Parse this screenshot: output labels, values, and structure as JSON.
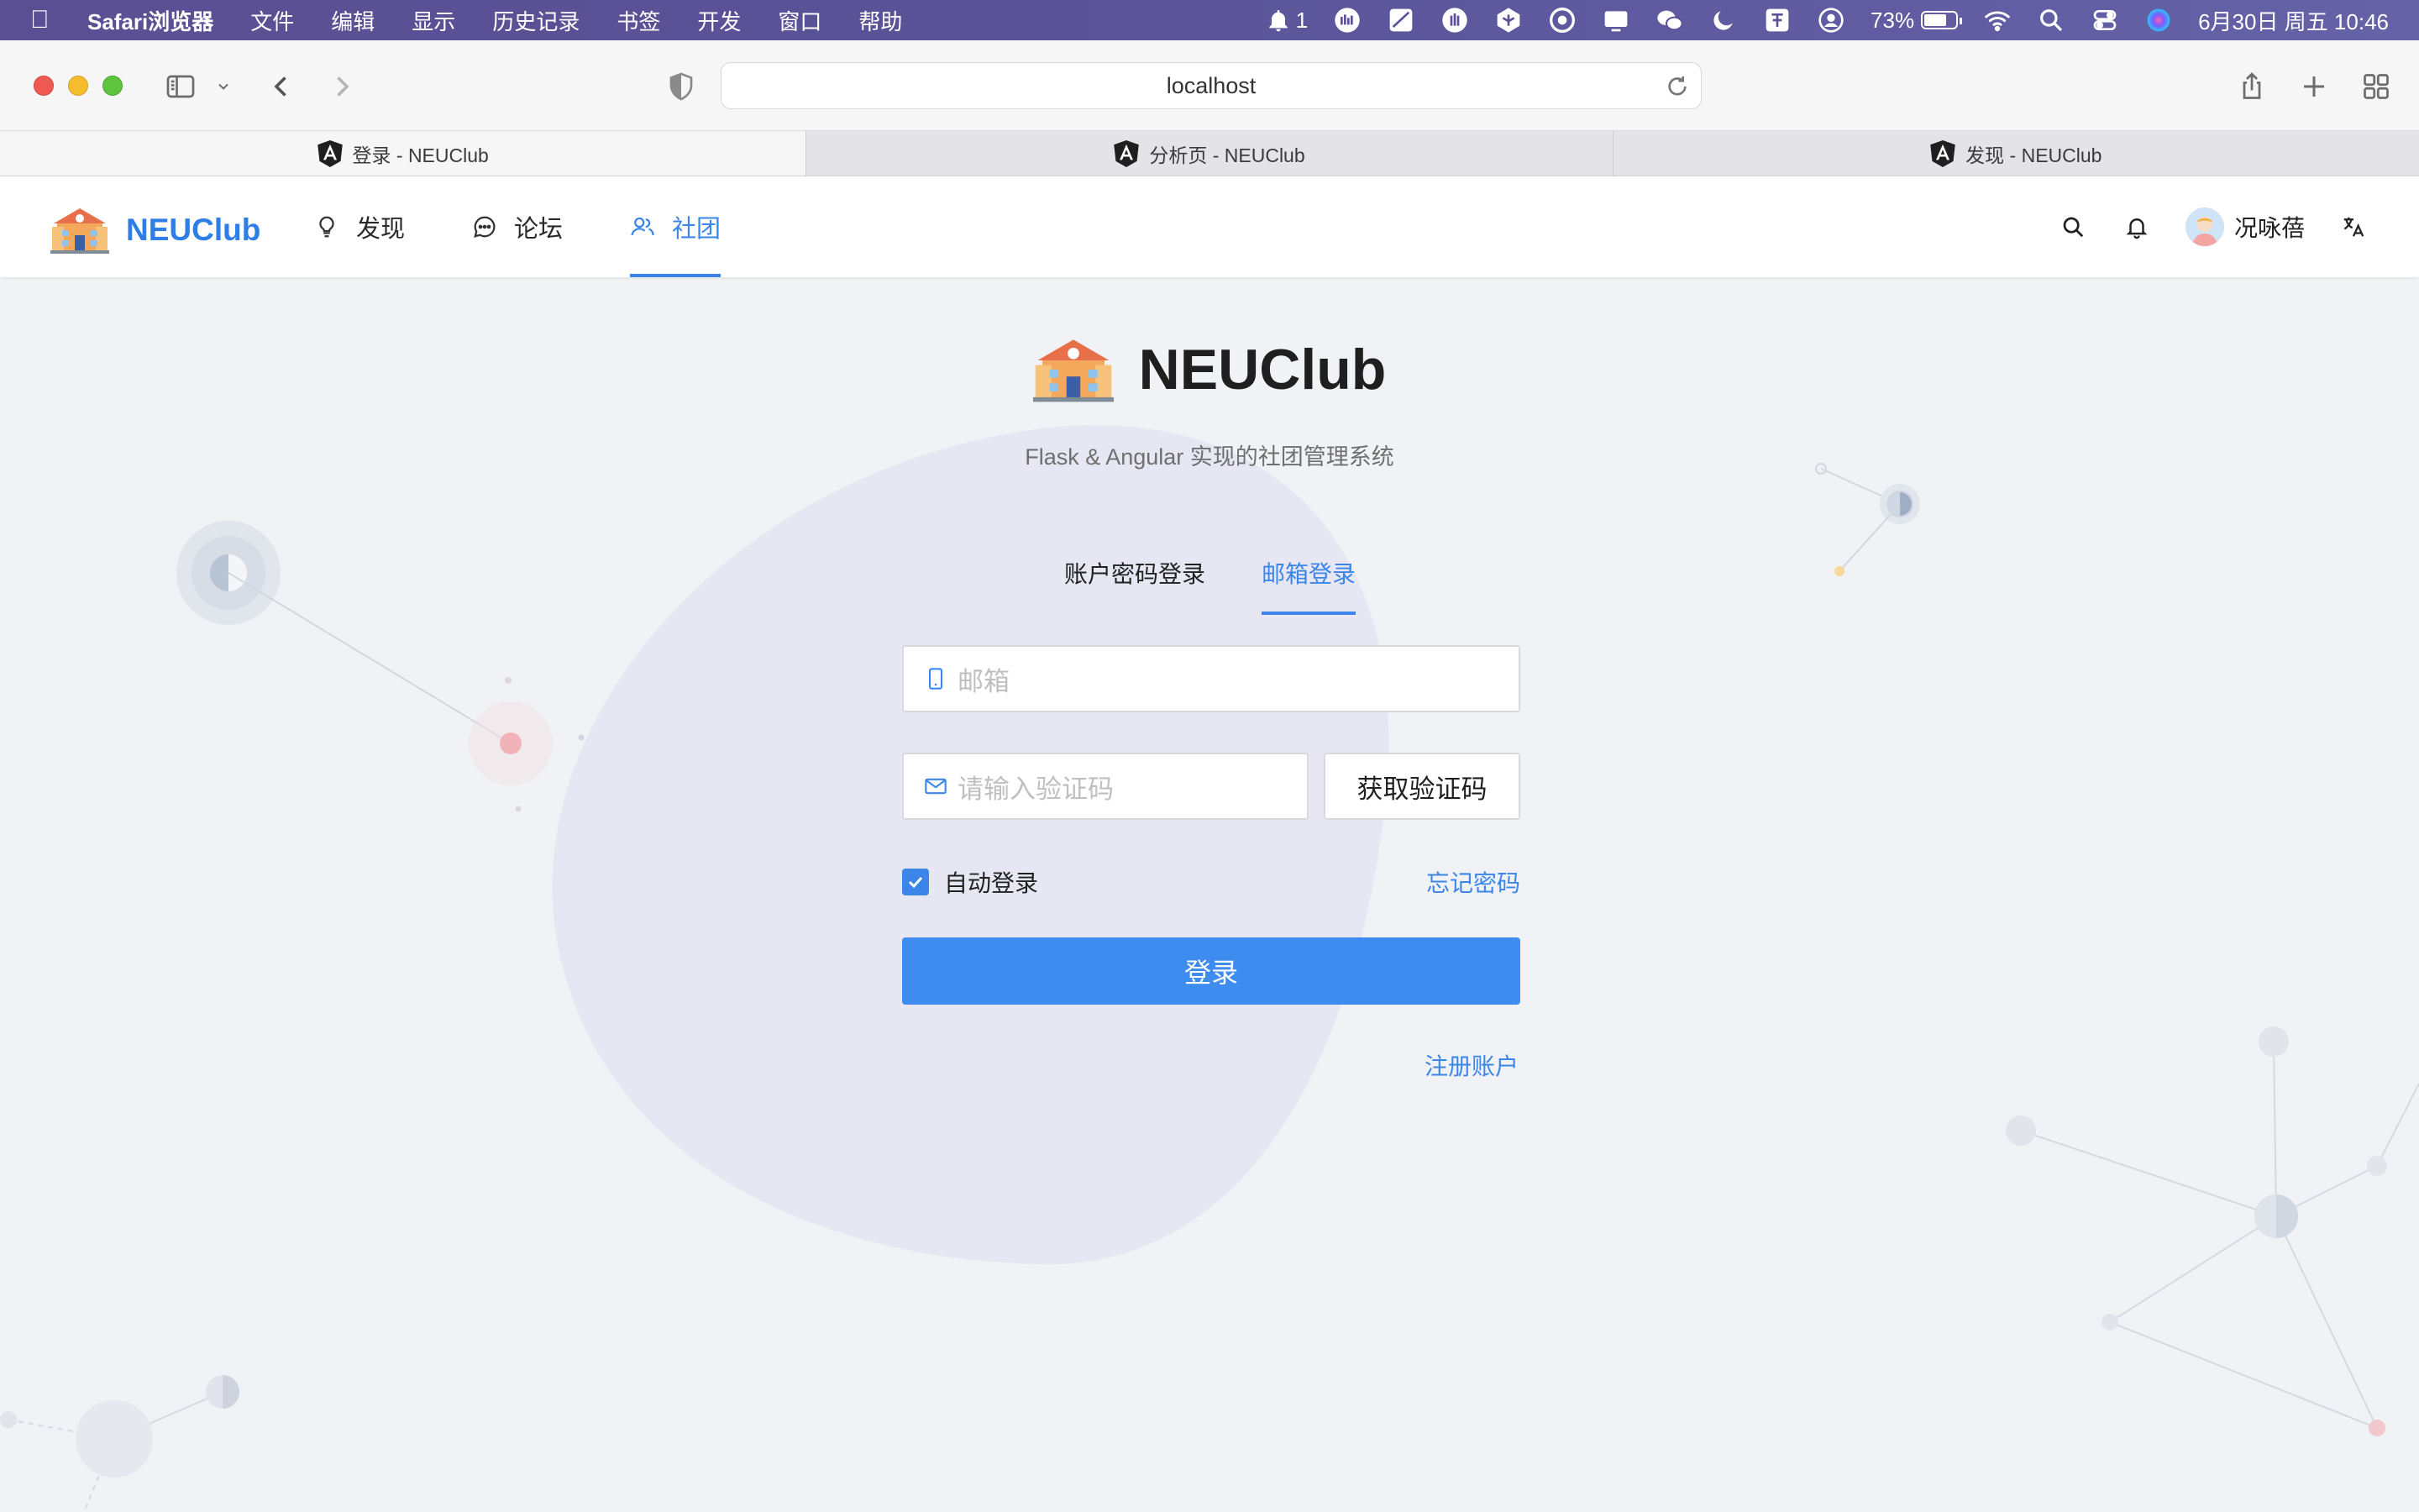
{
  "menubar": {
    "app_name": "Safari浏览器",
    "items": [
      "文件",
      "编辑",
      "显示",
      "历史记录",
      "书签",
      "开发",
      "窗口",
      "帮助"
    ],
    "notification_count": "1",
    "battery": "73%",
    "battery_level": 0.73,
    "datetime": "6月30日 周五 10:46"
  },
  "browser": {
    "url": "localhost",
    "tabs": [
      {
        "title": "登录 - NEUClub"
      },
      {
        "title": "分析页 - NEUClub"
      },
      {
        "title": "发现 - NEUClub"
      }
    ]
  },
  "header": {
    "brand": "NEUClub",
    "nav": [
      {
        "label": "发现",
        "icon": "bulb-icon"
      },
      {
        "label": "论坛",
        "icon": "message-icon"
      },
      {
        "label": "社团",
        "icon": "team-icon"
      }
    ],
    "user_name": "况咏蓓"
  },
  "login": {
    "title": "NEUClub",
    "subtitle": "Flask & Angular 实现的社团管理系统",
    "tab_password": "账户密码登录",
    "tab_email": "邮箱登录",
    "email_placeholder": "邮箱",
    "code_placeholder": "请输入验证码",
    "get_code": "获取验证码",
    "remember": "自动登录",
    "forgot": "忘记密码",
    "submit": "登录",
    "register": "注册账户"
  },
  "colors": {
    "primary": "#3b86e8",
    "menubar": "#5b4f93",
    "background": "#f0f2f5"
  }
}
